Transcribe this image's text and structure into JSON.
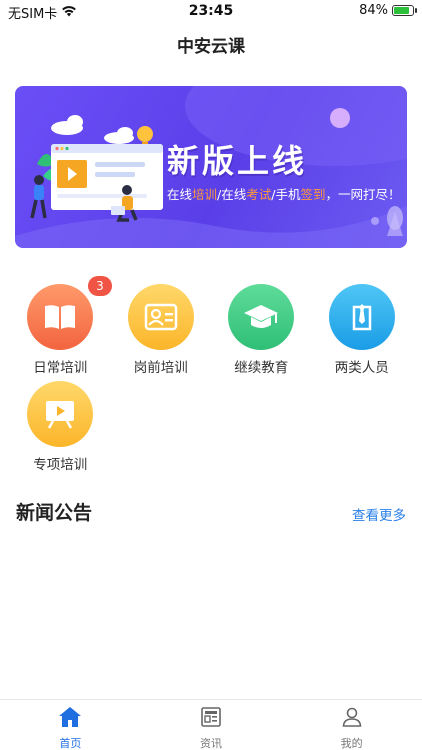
{
  "status_bar": {
    "carrier": "无SIM卡",
    "time": "23:45",
    "battery": "84%",
    "battery_level": 0.84
  },
  "nav": {
    "title": "中安云课"
  },
  "banner": {
    "title": "新版上线",
    "sub_parts": [
      "在线",
      "培训",
      "/在线",
      "考试",
      "/手机",
      "签到",
      "，一网打尽！"
    ],
    "highlight_color": "#ff9a3c"
  },
  "menu": [
    {
      "label": "日常培训",
      "icon": "book-icon",
      "badge": "3",
      "color_from": "#ff9a6b",
      "color_to": "#f2643f"
    },
    {
      "label": "岗前培训",
      "icon": "id-card-icon",
      "color_from": "#ffd86a",
      "color_to": "#fbb52a"
    },
    {
      "label": "继续教育",
      "icon": "graduation-cap-icon",
      "color_from": "#5fdc9a",
      "color_to": "#2fbf76"
    },
    {
      "label": "两类人员",
      "icon": "tie-icon",
      "color_from": "#4fc6f5",
      "color_to": "#1a9ce6"
    },
    {
      "label": "专项培训",
      "icon": "video-board-icon",
      "color_from": "#ffd86a",
      "color_to": "#fbb52a"
    }
  ],
  "news": {
    "title": "新闻公告",
    "more": "查看更多"
  },
  "tabs": [
    {
      "label": "首页",
      "icon": "home-icon",
      "active": true
    },
    {
      "label": "资讯",
      "icon": "news-icon",
      "active": false
    },
    {
      "label": "我的",
      "icon": "user-icon",
      "active": false
    }
  ],
  "colors": {
    "accent": "#1f6fe0",
    "banner": "#5a3fe8",
    "badge": "#f05445"
  }
}
